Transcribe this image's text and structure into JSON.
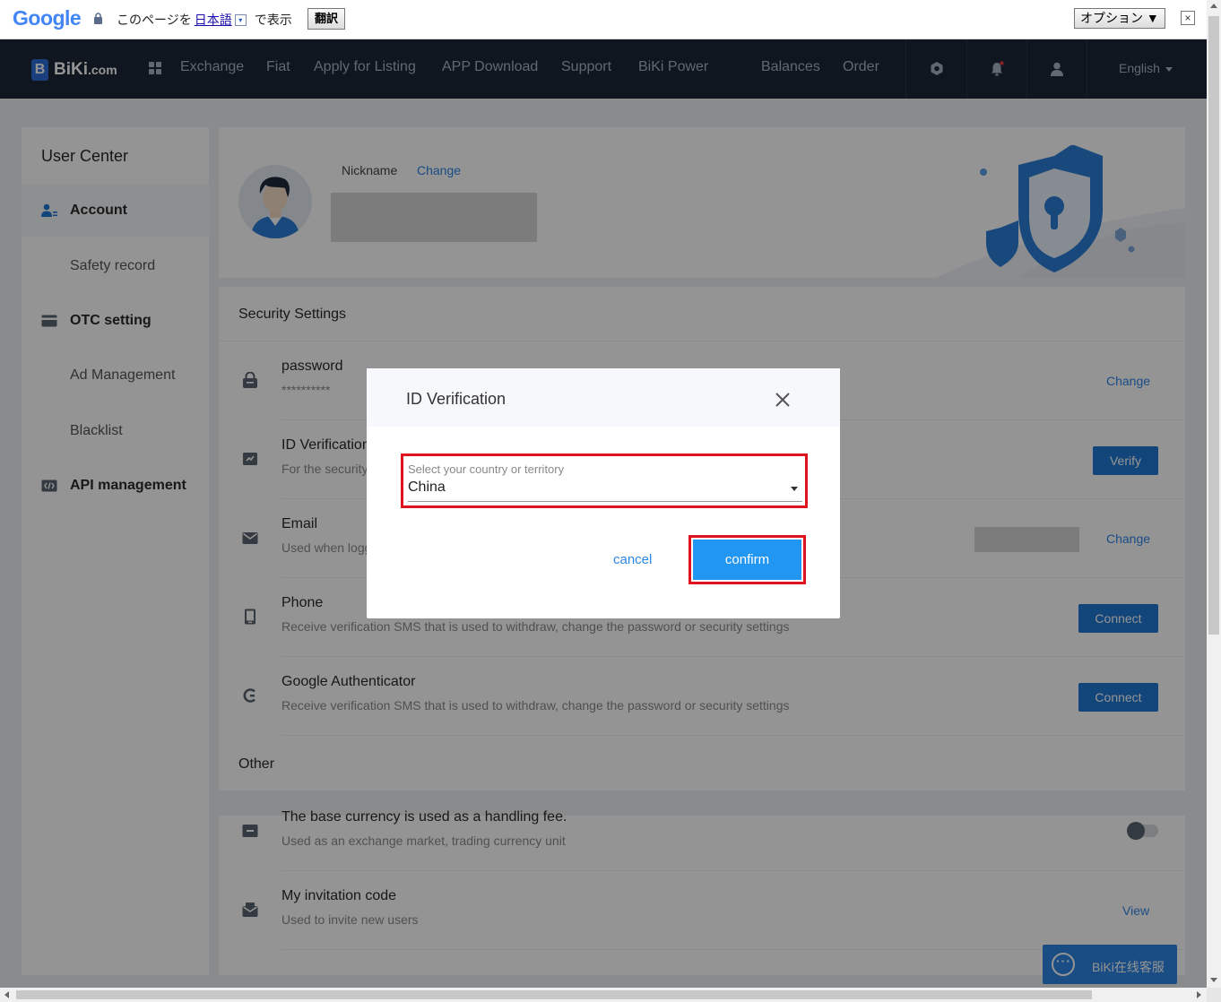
{
  "google_bar": {
    "logo": "Google",
    "text_prefix": "このページを",
    "language": "日本語",
    "lang_caret": "▾",
    "text_suffix": "で表示",
    "translate_button": "翻訳",
    "options_button": "オプション ▼",
    "close": "×"
  },
  "nav": {
    "logo_letter": "B",
    "logo_text": "BiKi",
    "logo_suffix": ".com",
    "items": [
      "Exchange",
      "Fiat",
      "Apply for Listing",
      "APP Download",
      "Support",
      "BiKi Power",
      "Balances",
      "Order"
    ],
    "language": "English"
  },
  "sidebar": {
    "title": "User Center",
    "items": [
      {
        "label": "Account",
        "icon": "account-icon"
      },
      {
        "label": "Safety record"
      },
      {
        "label": "OTC setting",
        "icon": "card-icon"
      },
      {
        "label": "Ad Management"
      },
      {
        "label": "Blacklist"
      },
      {
        "label": "API management",
        "icon": "api-icon"
      }
    ]
  },
  "profile": {
    "nickname_label": "Nickname",
    "change_link": "Change"
  },
  "security": {
    "title": "Security Settings",
    "rows": [
      {
        "title": "password",
        "subtitle": "**********",
        "action": "Change"
      },
      {
        "title": "ID Verification",
        "subtitle": "For the security",
        "action": "Verify"
      },
      {
        "title": "Email",
        "subtitle": "Used when logg",
        "action": "Change"
      },
      {
        "title": "Phone",
        "subtitle": "Receive verification SMS that is used to withdraw, change the password or security settings",
        "action": "Connect"
      },
      {
        "title": "Google Authenticator",
        "subtitle": "Receive verification SMS that is used to withdraw, change the password or security settings",
        "action": "Connect"
      }
    ]
  },
  "other": {
    "title": "Other",
    "rows": [
      {
        "title": "The base currency is used as a handling fee.",
        "subtitle": "Used as an exchange market, trading currency unit"
      },
      {
        "title": "My invitation code",
        "subtitle": "Used to invite new users",
        "action": "View"
      }
    ]
  },
  "chat": {
    "label": "BiKi在线客服"
  },
  "modal": {
    "title": "ID Verification",
    "field_label": "Select your country or territory",
    "field_value": "China",
    "cancel": "cancel",
    "confirm": "confirm"
  },
  "colors": {
    "nav_bg": "#1c2738",
    "primary_button": "#1f78d1",
    "link": "#2d86e3",
    "confirm": "#2196f3",
    "highlight": "#e0121e"
  }
}
